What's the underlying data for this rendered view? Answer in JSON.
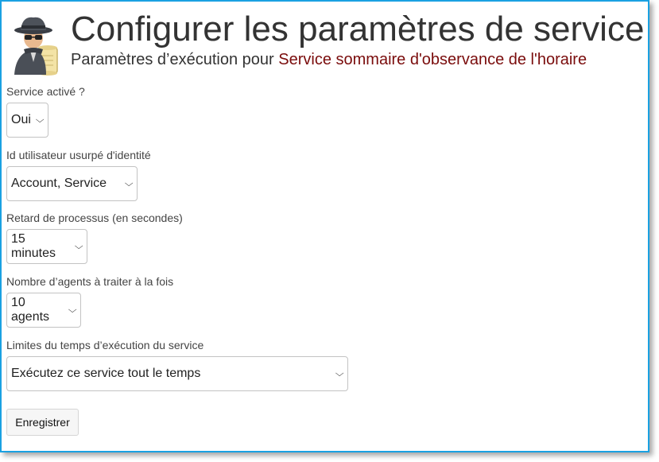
{
  "header": {
    "title": "Configurer les paramètres de service",
    "subtitle_prefix": "Paramètres d’exécution pour",
    "service_name": "Service sommaire d'observance de l'horaire",
    "accent_color": "#7a0c0c"
  },
  "fields": {
    "service_enabled": {
      "label": "Service activé ?",
      "value": "Oui"
    },
    "impersonation": {
      "label": "Id utilisateur usurpé d'identité",
      "value": "Account, Service"
    },
    "process_delay": {
      "label": "Retard de processus (en secondes)",
      "value": "15 minutes"
    },
    "agents_batch": {
      "label": "Nombre d’agents à traiter à la fois",
      "value": "10 agents"
    },
    "runtime_limits": {
      "label": "Limites du temps d’exécution du service",
      "value": "Exécutez ce service tout le temps"
    }
  },
  "buttons": {
    "save": "Enregistrer"
  },
  "icons": {
    "logo": "spy-agent-icon",
    "dropdown": "chevron-down-icon"
  }
}
